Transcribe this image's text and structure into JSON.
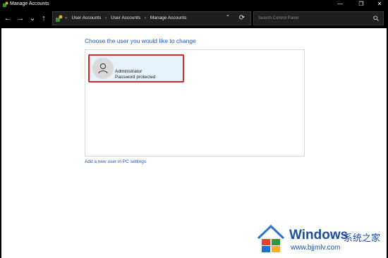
{
  "window": {
    "title": "Manage Accounts",
    "minimize_glyph": "—",
    "maximize_glyph": "❐",
    "close_glyph": "✕"
  },
  "nav": {
    "back_glyph": "←",
    "forward_glyph": "→",
    "recent_glyph": "⌄",
    "up_glyph": "↑",
    "refresh_glyph": "⟳",
    "dropdown_glyph": "⌄"
  },
  "address": {
    "lead": "«",
    "breadcrumbs": [
      "User Accounts",
      "User Accounts",
      "Manage Accounts"
    ],
    "separator": "›"
  },
  "search": {
    "placeholder": "Search Control Panel",
    "icon": "search-icon"
  },
  "main": {
    "heading": "Choose the user you would like to change",
    "users": [
      {
        "name": "Administrator",
        "status": "Password protected",
        "icon": "user-icon",
        "highlight_color": "#d9262a"
      }
    ],
    "add_user_link": "Add a new user in PC settings"
  },
  "watermark": {
    "brand": "Windows",
    "brand_cn": "系统之家",
    "url": "www.bjjmlv.com"
  },
  "colors": {
    "accent_link": "#1f56b5",
    "selected_tile": "#e5f1fb",
    "highlight_border": "#d9262a"
  }
}
